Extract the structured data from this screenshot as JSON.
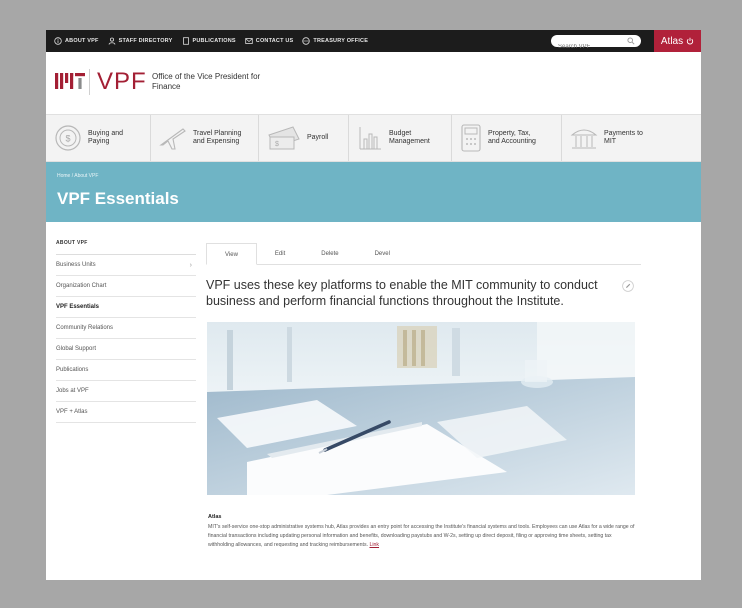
{
  "topbar": {
    "items": [
      {
        "label": "ABOUT VPF",
        "icon": "info-icon"
      },
      {
        "label": "STAFF DIRECTORY",
        "icon": "person-icon"
      },
      {
        "label": "PUBLICATIONS",
        "icon": "document-icon"
      },
      {
        "label": "CONTACT US",
        "icon": "mail-icon"
      },
      {
        "label": "TREASURY OFFICE",
        "icon": "globe-icon"
      }
    ],
    "search_placeholder": "Search VPF",
    "atlas_label": "Atlas"
  },
  "header": {
    "mit_logo": "MIT",
    "vpf_logo": "VPF",
    "office_title": "Office of the Vice President for Finance"
  },
  "categories": [
    {
      "label": "Buying and\nPaying",
      "icon": "coin-icon"
    },
    {
      "label": "Travel Planning\nand Expensing",
      "icon": "airplane-icon"
    },
    {
      "label": "Payroll",
      "icon": "money-icon"
    },
    {
      "label": "Budget\nManagement",
      "icon": "bar-chart-icon"
    },
    {
      "label": "Property, Tax,\nand Accounting",
      "icon": "calculator-icon"
    },
    {
      "label": "Payments to\nMIT",
      "icon": "building-icon"
    }
  ],
  "banner": {
    "breadcrumb": "Home / About VPF",
    "title": "VPF Essentials"
  },
  "sidebar": {
    "heading": "ABOUT VPF",
    "items": [
      {
        "label": "Business Units",
        "has_chevron": true
      },
      {
        "label": "Organization Chart"
      },
      {
        "label": "VPF Essentials",
        "active": true
      },
      {
        "label": "Community Relations"
      },
      {
        "label": "Global Support"
      },
      {
        "label": "Publications"
      },
      {
        "label": "Jobs at VPF"
      },
      {
        "label": "VPF + Atlas"
      }
    ]
  },
  "tabs": [
    {
      "label": "View",
      "active": true
    },
    {
      "label": "Edit"
    },
    {
      "label": "Delete"
    },
    {
      "label": "Devel"
    }
  ],
  "main": {
    "intro": "VPF uses these key platforms to enable the MIT community to conduct business and perform financial functions throughout the Institute.",
    "article_title": "Atlas",
    "article_body": "MIT's self-service one-stop administrative systems hub, Atlas provides an entry point for accessing the Institute's financial systems and tools. Employees can use Atlas for a wide range of financial transactions including updating personal information and benefits, downloading paystubs and W-2s, setting up direct deposit, filing or approving time sheets, setting tax withholding allowances, and requesting and tracking reimbursements.",
    "article_link": "Link"
  },
  "colors": {
    "mit_red": "#a31f34",
    "banner_teal": "#6fb4c5",
    "topbar": "#1c1c1c"
  }
}
